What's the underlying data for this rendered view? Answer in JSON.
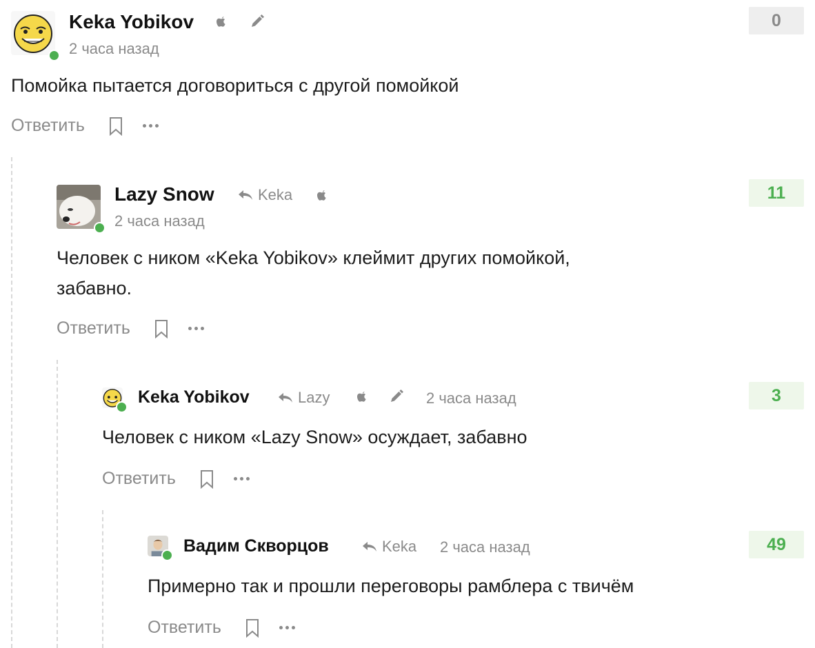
{
  "colors": {
    "online": "#4caf50",
    "score_positive_text": "#4caf50",
    "score_positive_bg": "#eef7ea",
    "score_neutral_bg": "#eeeeee",
    "muted": "#8a8a8a"
  },
  "actions": {
    "reply_label": "Ответить",
    "bookmark_icon": "bookmark-icon",
    "more_icon": "more-dots-icon"
  },
  "comments": [
    {
      "author": "Keka Yobikov",
      "time": "2 часа назад",
      "text": "Помойка пытается договориться с другой помойкой",
      "score": "0",
      "icons": [
        "apple-icon",
        "pencil-icon"
      ]
    },
    {
      "author": "Lazy Snow",
      "reply_to": "Keka",
      "time": "2 часа назад",
      "text": "Человек с ником «Keka Yobikov» клеймит других помойкой, забавно.",
      "score": "11",
      "icons": [
        "apple-icon"
      ]
    },
    {
      "author": "Keka Yobikov",
      "reply_to": "Lazy",
      "time": "2 часа назад",
      "text": "Человек с ником «Lazy Snow» осуждает, забавно",
      "score": "3",
      "icons": [
        "apple-icon",
        "pencil-icon"
      ]
    },
    {
      "author": "Вадим Скворцов",
      "reply_to": "Keka",
      "time": "2 часа назад",
      "text": "Примерно так и прошли переговоры рамблера с твичём",
      "score": "49",
      "icons": []
    }
  ]
}
